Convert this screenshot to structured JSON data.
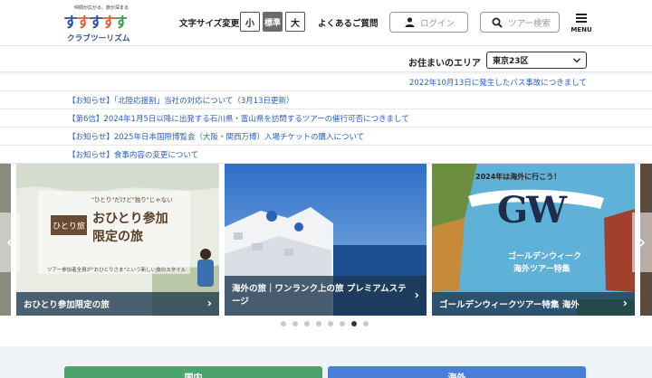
{
  "header": {
    "logo_tagline": "仲間が広がる、旅が深まる",
    "logo_name": "クラブツーリズム",
    "font_size_label": "文字サイズ変更",
    "font_size_options": [
      "小",
      "標準",
      "大"
    ],
    "faq": "よくあるご質問",
    "login_label": "ログイン",
    "search_placeholder": "ツアー検索",
    "menu_label": "MENU"
  },
  "area": {
    "label": "お住まいのエリア",
    "selected": "東京23区"
  },
  "news": [
    "2022年10月13日に発生したバス事故につきまして",
    "【お知らせ】「北陸応援割」当社の対応について（3月13日更新）",
    "【第6信】2024年1月5日以降に出発する石川県・富山県を訪問するツアーの催行可否につきまして",
    "【お知らせ】2025年日本国際博覧会（大阪・関西万博）入場チケットの購入について",
    "【お知らせ】食事内容の変更について"
  ],
  "carousel": {
    "cards": [
      {
        "caption": "おひとり参加限定の旅",
        "badge": "ひとり旅",
        "sub": "\"ひとり\"だけど\"独り\"じゃない",
        "headline_1": "おひとり参加",
        "headline_2": "限定の旅",
        "note": "ツアー参加者全員が\"おひとりさま\"という新しい旅のスタイル"
      },
      {
        "caption": "海外の旅｜ワンランク上の旅 プレミアムステージ"
      },
      {
        "caption": "ゴールデンウィークツアー特集 海外",
        "banner": "2024年は海外に行こう！",
        "big": "GW",
        "sub1": "ゴールデンウィーク",
        "sub2": "海外ツアー特集"
      }
    ],
    "dot_count": 8,
    "active_dot": 6
  },
  "bottom_tabs": [
    "国内",
    "海外"
  ],
  "colors": {
    "accent_blue": "#2b5fb8",
    "domestic_green": "#4aa46c",
    "overseas_blue": "#4a7ed6"
  }
}
